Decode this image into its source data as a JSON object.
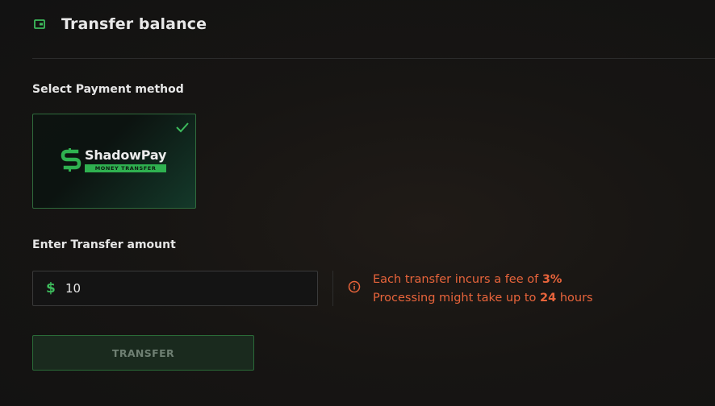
{
  "header": {
    "title": "Transfer balance",
    "icon": "wallet-icon"
  },
  "payment": {
    "label": "Select Payment method",
    "selected_method": {
      "name": "ShadowPay",
      "subtitle": "MONEY TRANSFER",
      "selected": true
    }
  },
  "amount": {
    "label": "Enter Transfer amount",
    "currency_symbol": "$",
    "value": "10"
  },
  "fee_info": {
    "line1_prefix": "Each transfer incurs a fee of ",
    "fee_value": "3%",
    "line2_prefix": "Processing might take up to ",
    "hours_value": "24",
    "line2_suffix": " hours"
  },
  "actions": {
    "transfer_label": "TRANSFER"
  },
  "colors": {
    "accent_green": "#3dbb5c",
    "warning_orange": "#e8643b",
    "background": "#141414"
  }
}
